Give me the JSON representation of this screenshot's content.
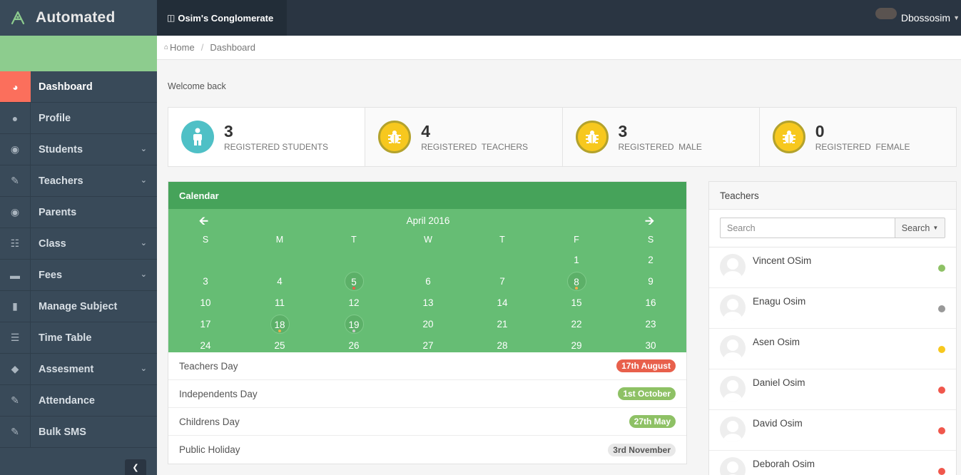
{
  "app": {
    "name": "Automated",
    "organization": "Osim's Conglomerate"
  },
  "user": {
    "name": "Dbossosim"
  },
  "sidebar": {
    "items": [
      {
        "label": "Dashboard",
        "icon": "dashboard-icon",
        "active": true,
        "has_submenu": false
      },
      {
        "label": "Profile",
        "icon": "user-icon",
        "has_submenu": false
      },
      {
        "label": "Students",
        "icon": "users-icon",
        "has_submenu": true
      },
      {
        "label": "Teachers",
        "icon": "pencil-icon",
        "has_submenu": true
      },
      {
        "label": "Parents",
        "icon": "eye-icon",
        "has_submenu": false
      },
      {
        "label": "Class",
        "icon": "sitemap-icon",
        "has_submenu": true
      },
      {
        "label": "Fees",
        "icon": "credit-card-icon",
        "has_submenu": true
      },
      {
        "label": "Manage Subject",
        "icon": "book-icon",
        "has_submenu": false
      },
      {
        "label": "Time Table",
        "icon": "list-icon",
        "has_submenu": false
      },
      {
        "label": "Assesment",
        "icon": "tag-icon",
        "has_submenu": true
      },
      {
        "label": "Attendance",
        "icon": "edit-icon",
        "has_submenu": false
      },
      {
        "label": "Bulk SMS",
        "icon": "edit-icon",
        "has_submenu": false
      }
    ]
  },
  "breadcrumb": {
    "home": "Home",
    "current": "Dashboard"
  },
  "welcome": "Welcome back",
  "stats": [
    {
      "value": "3",
      "label": "REGISTERED STUDENTS",
      "icon": "child-icon",
      "color": "#4fc0c6"
    },
    {
      "value": "4",
      "label": "REGISTERED  TEACHERS",
      "icon": "bug-icon",
      "color": "#f7c81e"
    },
    {
      "value": "3",
      "label": "REGISTERED  MALE",
      "icon": "bug-icon",
      "color": "#f7c81e"
    },
    {
      "value": "0",
      "label": "REGISTERED  FEMALE",
      "icon": "bug-icon",
      "color": "#f7c81e"
    }
  ],
  "calendar": {
    "title": "Calendar",
    "month": "April 2016",
    "weekdays": [
      "S",
      "M",
      "T",
      "W",
      "T",
      "F",
      "S"
    ],
    "weeks": [
      [
        "",
        "",
        "",
        "",
        "",
        "1",
        "2"
      ],
      [
        "3",
        "4",
        "5",
        "6",
        "7",
        "8",
        "9"
      ],
      [
        "10",
        "11",
        "12",
        "13",
        "14",
        "15",
        "16"
      ],
      [
        "17",
        "18",
        "19",
        "20",
        "21",
        "22",
        "23"
      ],
      [
        "24",
        "25",
        "26",
        "27",
        "28",
        "29",
        "30"
      ]
    ],
    "event_days": [
      {
        "day": "5",
        "dot_color": "#e8604c"
      },
      {
        "day": "8",
        "dot_color": "#f0ad4e"
      },
      {
        "day": "18",
        "dot_color": "#f0ad4e"
      },
      {
        "day": "19",
        "dot_color": "#cccccc"
      }
    ]
  },
  "events": [
    {
      "name": "Teachers Day",
      "date": "17th August",
      "color": "#e8604c"
    },
    {
      "name": "Independents Day",
      "date": "1st October",
      "color": "#8ec165"
    },
    {
      "name": "Childrens Day",
      "date": "27th May",
      "color": "#8ec165"
    },
    {
      "name": "Public Holiday",
      "date": "3rd November",
      "color": "#e8e8e8",
      "text_color": "#555555"
    }
  ],
  "teachers": {
    "title": "Teachers",
    "search_placeholder": "Search",
    "search_button": "Search",
    "list": [
      {
        "name": "Vincent OSim",
        "status_color": "#8ec165"
      },
      {
        "name": "Enagu Osim",
        "status_color": "#999999"
      },
      {
        "name": "Asen Osim",
        "status_color": "#f7c81e"
      },
      {
        "name": "Daniel Osim",
        "status_color": "#f0574c"
      },
      {
        "name": "David Osim",
        "status_color": "#f0574c"
      },
      {
        "name": "Deborah Osim",
        "status_color": "#f0574c"
      }
    ]
  }
}
